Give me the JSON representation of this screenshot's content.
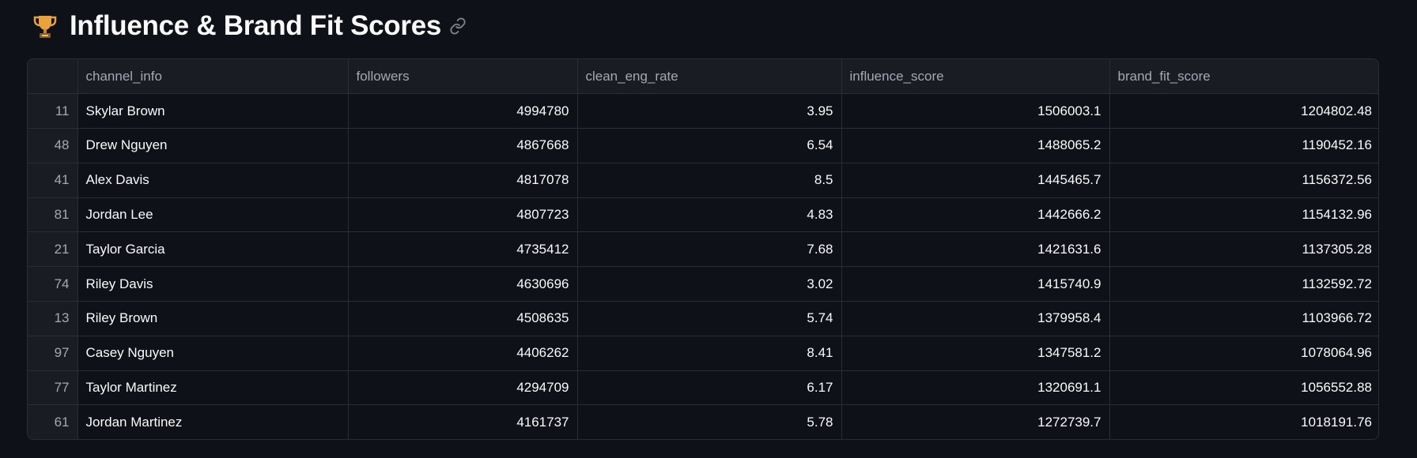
{
  "header": {
    "icon": "trophy-icon",
    "title": "Influence & Brand Fit Scores"
  },
  "table": {
    "columns": [
      "",
      "channel_info",
      "followers",
      "clean_eng_rate",
      "influence_score",
      "brand_fit_score"
    ],
    "rows": [
      {
        "index": "11",
        "channel_info": "Skylar Brown",
        "followers": "4994780",
        "clean_eng_rate": "3.95",
        "influence_score": "1506003.1",
        "brand_fit_score": "1204802.48"
      },
      {
        "index": "48",
        "channel_info": "Drew Nguyen",
        "followers": "4867668",
        "clean_eng_rate": "6.54",
        "influence_score": "1488065.2",
        "brand_fit_score": "1190452.16"
      },
      {
        "index": "41",
        "channel_info": "Alex Davis",
        "followers": "4817078",
        "clean_eng_rate": "8.5",
        "influence_score": "1445465.7",
        "brand_fit_score": "1156372.56"
      },
      {
        "index": "81",
        "channel_info": "Jordan Lee",
        "followers": "4807723",
        "clean_eng_rate": "4.83",
        "influence_score": "1442666.2",
        "brand_fit_score": "1154132.96"
      },
      {
        "index": "21",
        "channel_info": "Taylor Garcia",
        "followers": "4735412",
        "clean_eng_rate": "7.68",
        "influence_score": "1421631.6",
        "brand_fit_score": "1137305.28"
      },
      {
        "index": "74",
        "channel_info": "Riley Davis",
        "followers": "4630696",
        "clean_eng_rate": "3.02",
        "influence_score": "1415740.9",
        "brand_fit_score": "1132592.72"
      },
      {
        "index": "13",
        "channel_info": "Riley Brown",
        "followers": "4508635",
        "clean_eng_rate": "5.74",
        "influence_score": "1379958.4",
        "brand_fit_score": "1103966.72"
      },
      {
        "index": "97",
        "channel_info": "Casey Nguyen",
        "followers": "4406262",
        "clean_eng_rate": "8.41",
        "influence_score": "1347581.2",
        "brand_fit_score": "1078064.96"
      },
      {
        "index": "77",
        "channel_info": "Taylor Martinez",
        "followers": "4294709",
        "clean_eng_rate": "6.17",
        "influence_score": "1320691.1",
        "brand_fit_score": "1056552.88"
      },
      {
        "index": "61",
        "channel_info": "Jordan Martinez",
        "followers": "4161737",
        "clean_eng_rate": "5.78",
        "influence_score": "1272739.7",
        "brand_fit_score": "1018191.76"
      }
    ]
  }
}
